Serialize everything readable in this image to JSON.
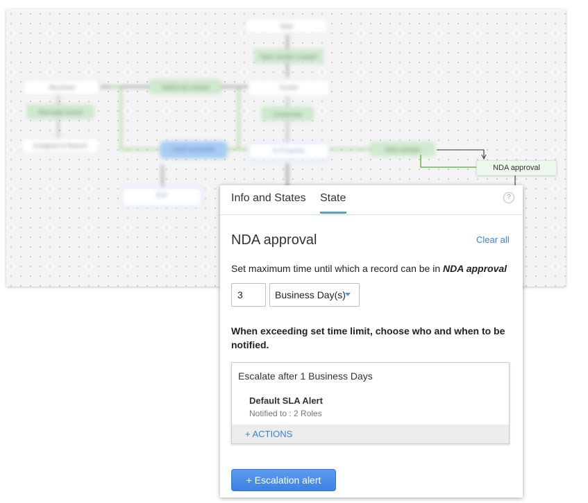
{
  "canvas": {
    "highlighted_node": "NDA approval"
  },
  "panel": {
    "tabs": [
      {
        "label": "Info and States"
      },
      {
        "label": "State"
      }
    ],
    "active_tab": "State",
    "help_icon": "?",
    "title": "NDA approval",
    "clear_all": "Clear all",
    "set_time_prefix": "Set maximum time until which a record can be in ",
    "set_time_state": "NDA approval",
    "time_value": "3",
    "time_unit": "Business Day(s)",
    "exceed_text": "When exceeding set time limit, choose who and when to be notified.",
    "escalation": {
      "header": "Escalate after 1 Business Days",
      "alert_name": "Default SLA Alert",
      "alert_notified": "Notified to : 2 Roles",
      "actions_label": "+ ACTIONS"
    },
    "escalation_button": {
      "icon": "+",
      "label": "Escalation alert"
    }
  },
  "colors": {
    "accent": "#3a7fd0",
    "button": "#4a90e8",
    "transition_green": "#7cc35a",
    "node_green": "#cfe9cf"
  }
}
